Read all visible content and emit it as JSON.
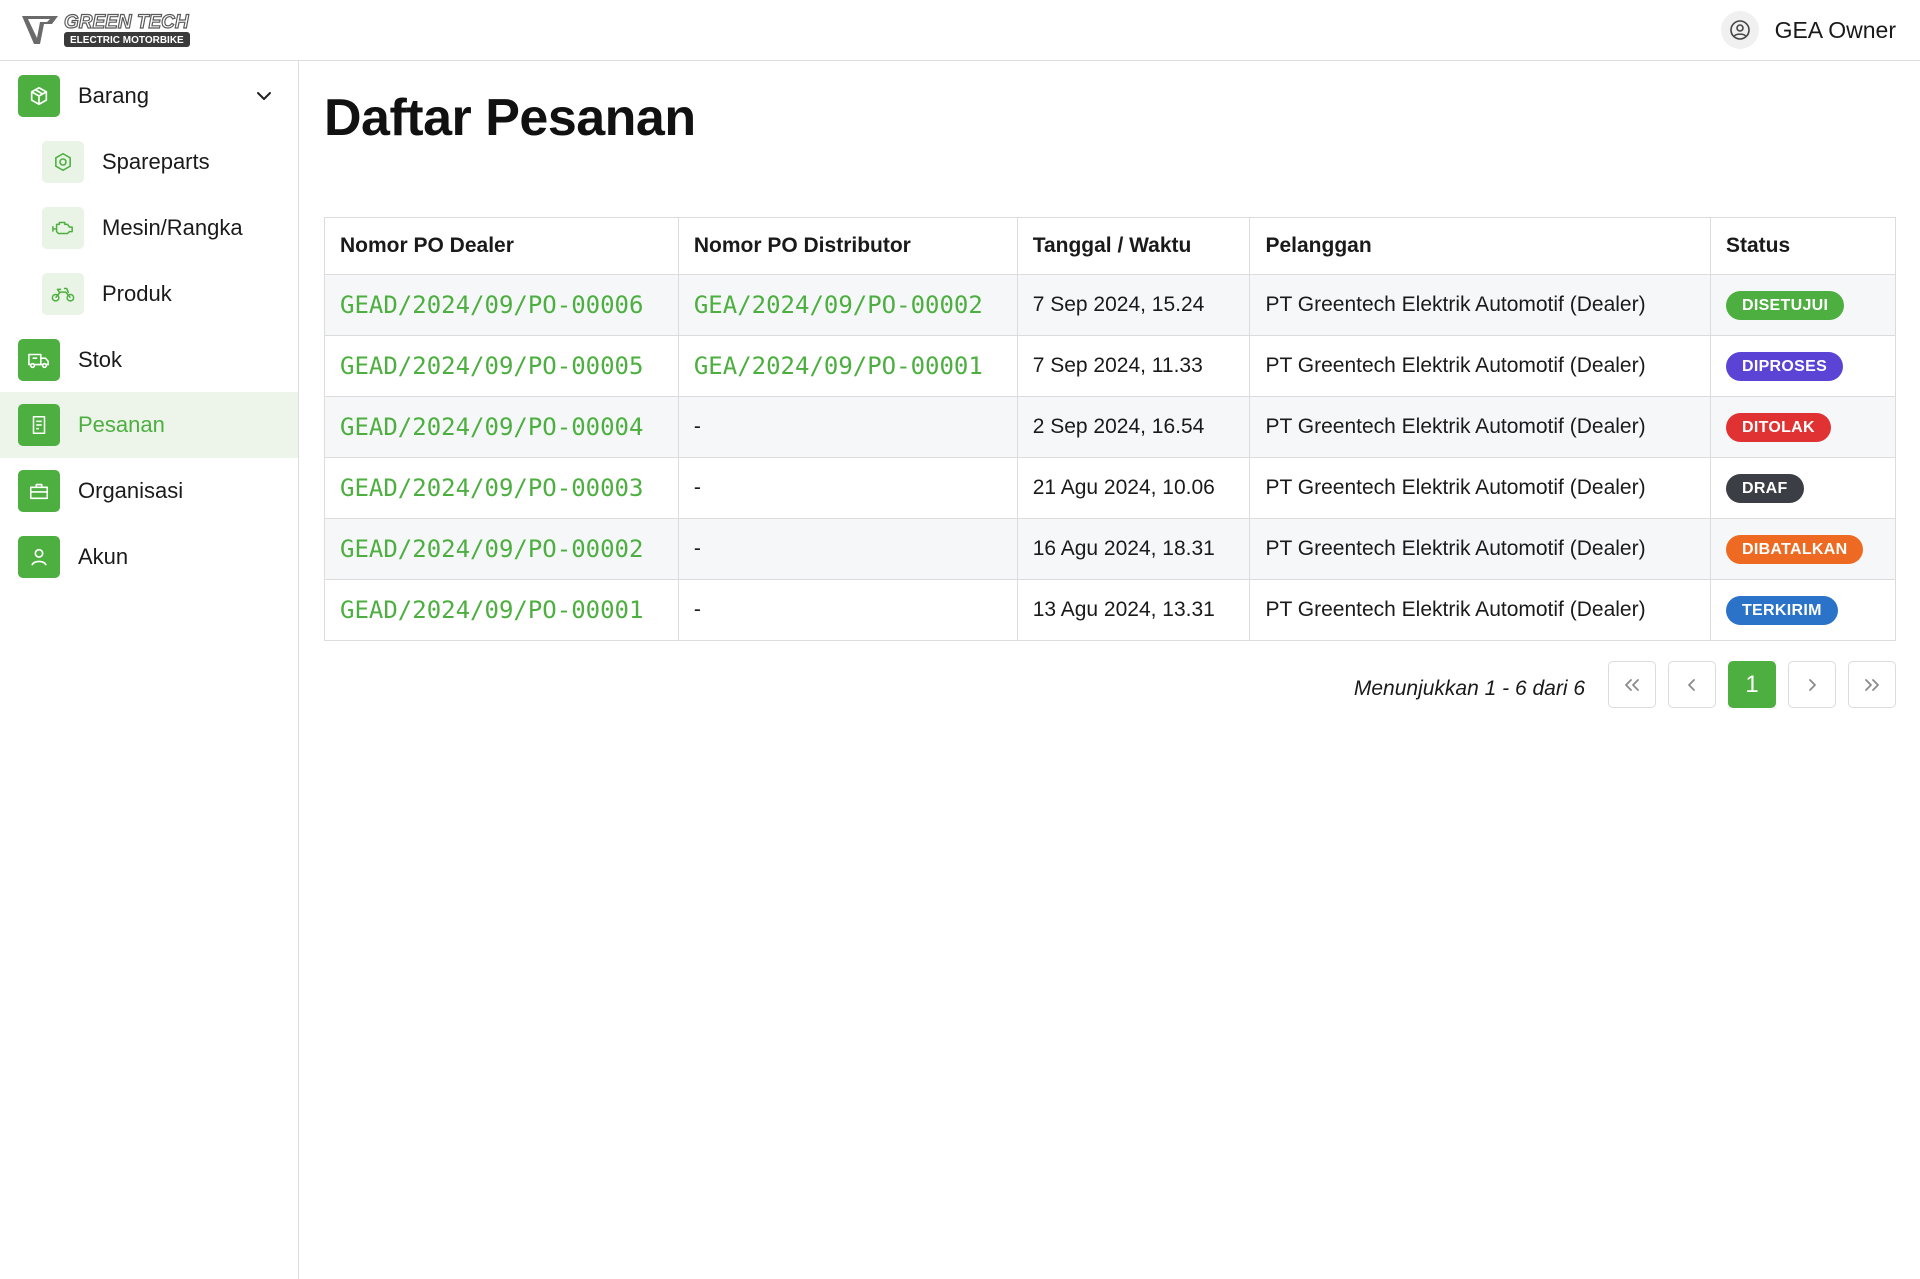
{
  "brand": {
    "name": "GREEN TECH",
    "tagline": "ELECTRIC MOTORBIKE",
    "accent": "#4caf3f"
  },
  "user": {
    "name": "GEA Owner",
    "icon": "user-circle-icon"
  },
  "sidebar": {
    "items": [
      {
        "label": "Barang",
        "icon": "box-icon",
        "expanded": true
      },
      {
        "label": "Stok",
        "icon": "truck-icon"
      },
      {
        "label": "Pesanan",
        "icon": "receipt-icon",
        "active": true
      },
      {
        "label": "Organisasi",
        "icon": "briefcase-icon"
      },
      {
        "label": "Akun",
        "icon": "user-icon"
      }
    ],
    "sub_items": [
      {
        "label": "Spareparts",
        "icon": "nut-icon"
      },
      {
        "label": "Mesin/Rangka",
        "icon": "engine-icon"
      },
      {
        "label": "Produk",
        "icon": "motorbike-icon"
      }
    ]
  },
  "page": {
    "title": "Daftar Pesanan"
  },
  "table": {
    "headers": [
      "Nomor PO Dealer",
      "Nomor PO Distributor",
      "Tanggal / Waktu",
      "Pelanggan",
      "Status"
    ],
    "rows": [
      {
        "po_dealer": "GEAD/2024/09/PO-00006",
        "po_distributor": "GEA/2024/09/PO-00002",
        "datetime": "7 Sep 2024, 15.24",
        "customer": "PT Greentech Elektrik Automotif (Dealer)",
        "status": "DISETUJUI",
        "status_color": "#4caf3f"
      },
      {
        "po_dealer": "GEAD/2024/09/PO-00005",
        "po_distributor": "GEA/2024/09/PO-00001",
        "datetime": "7 Sep 2024, 11.33",
        "customer": "PT Greentech Elektrik Automotif (Dealer)",
        "status": "DIPROSES",
        "status_color": "#5b43d6"
      },
      {
        "po_dealer": "GEAD/2024/09/PO-00004",
        "po_distributor": "-",
        "datetime": "2 Sep 2024, 16.54",
        "customer": "PT Greentech Elektrik Automotif (Dealer)",
        "status": "DITOLAK",
        "status_color": "#e03232"
      },
      {
        "po_dealer": "GEAD/2024/09/PO-00003",
        "po_distributor": "-",
        "datetime": "21 Agu 2024, 10.06",
        "customer": "PT Greentech Elektrik Automotif (Dealer)",
        "status": "DRAF",
        "status_color": "#3b3f45"
      },
      {
        "po_dealer": "GEAD/2024/09/PO-00002",
        "po_distributor": "-",
        "datetime": "16 Agu 2024, 18.31",
        "customer": "PT Greentech Elektrik Automotif (Dealer)",
        "status": "DIBATALKAN",
        "status_color": "#ee6a22"
      },
      {
        "po_dealer": "GEAD/2024/09/PO-00001",
        "po_distributor": "-",
        "datetime": "13 Agu 2024, 13.31",
        "customer": "PT Greentech Elektrik Automotif (Dealer)",
        "status": "TERKIRIM",
        "status_color": "#2a73c9"
      }
    ]
  },
  "pagination": {
    "summary": "Menunjukkan 1 - 6 dari 6",
    "first": "«",
    "prev": "‹",
    "current": "1",
    "next": "›",
    "last": "»"
  }
}
